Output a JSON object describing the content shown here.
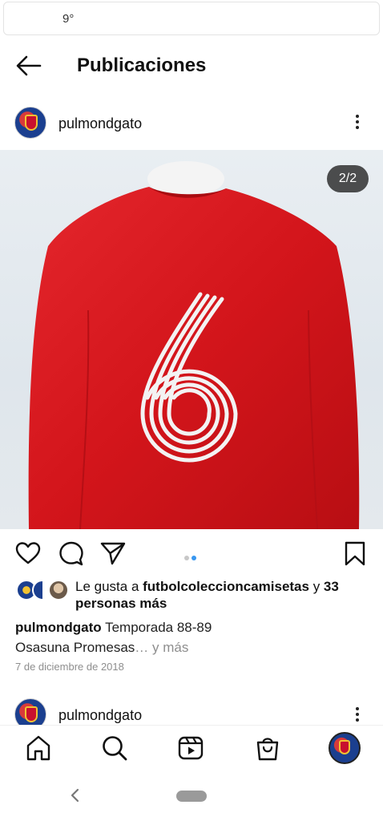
{
  "status_bar": {
    "temperature": "9°"
  },
  "header": {
    "title": "Publicaciones",
    "back_icon": "arrow-left-icon"
  },
  "post": {
    "username": "pulmondgato",
    "media_counter": "2/2",
    "carousel": {
      "total": 2,
      "active_index": 2,
      "active_color": "#3897f0",
      "inactive_color": "#c7c7c7"
    },
    "jersey_number": "6",
    "jersey_color": "#d8161c",
    "likes": {
      "prefix": "Le gusta a ",
      "liked_by": "futbolcoleccioncamisetas",
      "connector": " y ",
      "others": "33 personas más"
    },
    "caption": {
      "username": "pulmondgato",
      "text_line1": "Temporada 88-89",
      "text_line2": "Osasuna Promesas",
      "ellipsis": "…",
      "more": " y más"
    },
    "date": "7 de diciembre de 2018"
  },
  "next_post": {
    "username": "pulmondgato"
  },
  "icons": {
    "like": "heart-icon",
    "comment": "comment-icon",
    "share": "send-icon",
    "save": "bookmark-icon",
    "more": "more-vertical-icon"
  },
  "bottom_nav": [
    "home-icon",
    "search-icon",
    "reels-icon",
    "shop-icon",
    "profile-avatar"
  ],
  "system_nav": [
    "back-chevron-icon",
    "home-pill"
  ]
}
